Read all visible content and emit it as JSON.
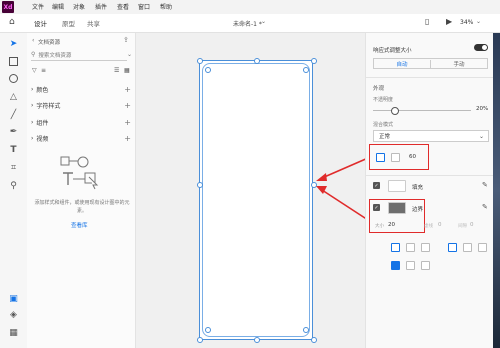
{
  "app": {
    "logo": "Xd",
    "doc_title": "未命名-1 *",
    "zoom": "34%"
  },
  "menu": [
    "文件",
    "编辑",
    "对象",
    "插件",
    "查看",
    "窗口",
    "帮助"
  ],
  "tabs": [
    "设计",
    "原型",
    "共享"
  ],
  "assets": {
    "back_label": "文档资源",
    "search_placeholder": "搜索文档资源",
    "sections": [
      "颜色",
      "字符样式",
      "组件",
      "视频"
    ],
    "empty_text": "添加样式和组件，或使用现有设计图中的元素。",
    "view_link": "查看库"
  },
  "props": {
    "responsive_label": "响应式调整大小",
    "auto_label": "自动",
    "manual_label": "手动",
    "appearance_label": "外观",
    "opacity_label": "不透明度",
    "opacity_value": "20%",
    "blend_label": "混合模式",
    "blend_value": "正常",
    "corner_value": "60",
    "fill_label": "填充",
    "border_label": "边界",
    "size_label": "大小",
    "size_value": "20",
    "dash_label": "虚线",
    "gap_value": "0",
    "gap_label": "间隙"
  },
  "colors": {
    "accent": "#1473e6",
    "highlight": "#e02b2b"
  }
}
